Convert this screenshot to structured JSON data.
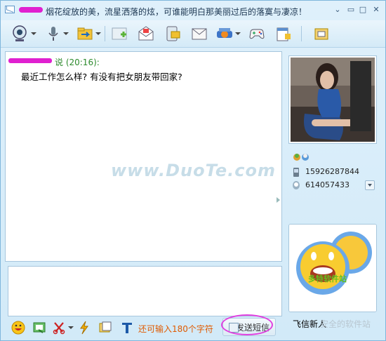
{
  "titlebar": {
    "title": "烟花绽放的美，流星洒落的炫，可谁能明白那美丽过后的落寞与凄凉！"
  },
  "window_buttons": {
    "menu": "⌄",
    "minimize": "▭",
    "maximize": "□",
    "close": "✕"
  },
  "toolbar_icons": [
    "camera-icon",
    "microphone-icon",
    "file-transfer-icon",
    "add-contact-icon",
    "email-icon",
    "sms-icon",
    "mail-icon",
    "gift-icon",
    "game-icon",
    "calendar-icon",
    "mailbox-icon"
  ],
  "chat": {
    "sender_suffix": "说 (20:16):",
    "message": "最近工作怎么样? 有没有把女朋友带回家?",
    "watermark": "www.DuoTe.com"
  },
  "bottombar": {
    "counter": "还可输入180个字符",
    "send_label": "发送短信",
    "icons": [
      "emoji-icon",
      "screenshot-icon",
      "scissors-icon",
      "lightning-icon",
      "window-icon",
      "font-icon"
    ]
  },
  "contact": {
    "phone": "15926287844",
    "qq": "614057433",
    "nickname": "飞信新人"
  },
  "watermarks": {
    "corner": "多特软件站",
    "footer": "安全的软件站"
  }
}
